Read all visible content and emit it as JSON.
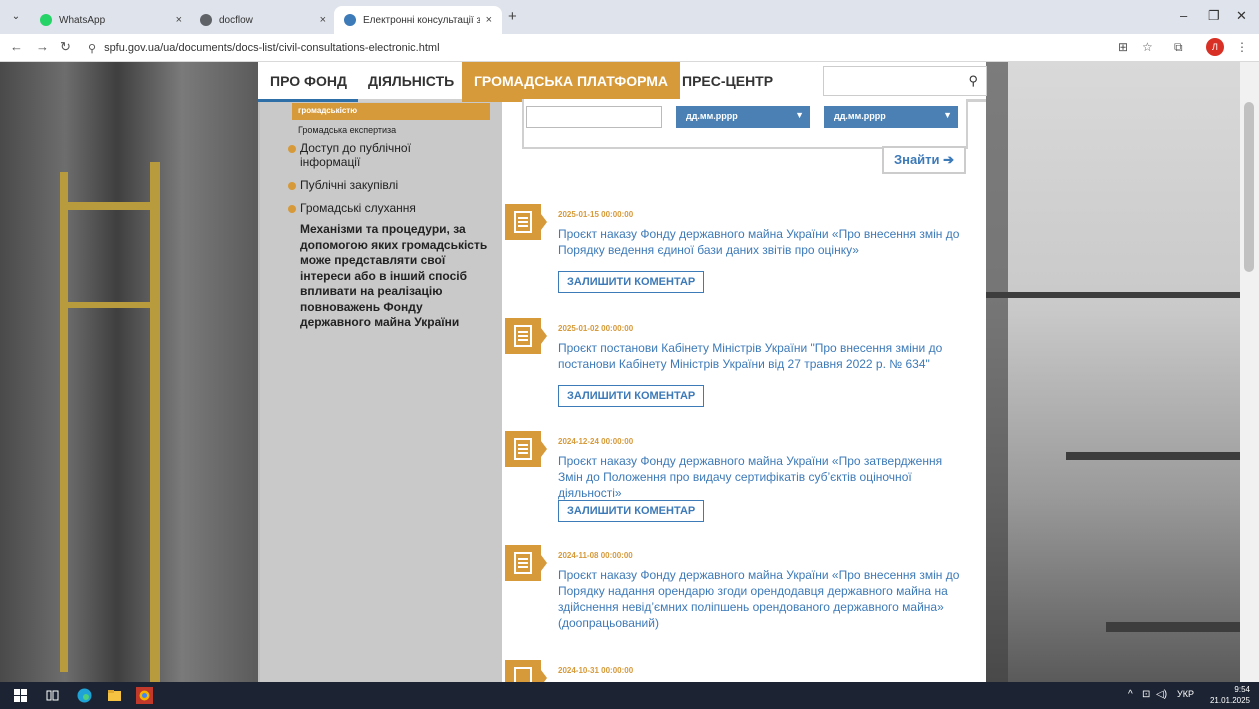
{
  "browser": {
    "tabs": [
      {
        "label": "WhatsApp",
        "icon": "whatsapp-icon",
        "color": "#25d366"
      },
      {
        "label": "docflow",
        "icon": "globe-icon",
        "color": "#5f6368"
      },
      {
        "label": "Електронні консультації з гром",
        "icon": "spfu-logo-icon",
        "color": "#3d7ab8"
      }
    ],
    "url": "spfu.gov.ua/ua/documents/docs-list/civil-consultations-electronic.html",
    "profile_initial": "Л"
  },
  "nav": {
    "items": [
      "ПРО ФОНД",
      "ДІЯЛЬНІСТЬ",
      "ГРОМАДСЬКА ПЛАТФОРМА",
      "ПРЕС-ЦЕНТР"
    ],
    "search_placeholder": ""
  },
  "sidebar": {
    "active_sub": "громадськістю",
    "small_item": "Громадська експертиза",
    "items": [
      "Доступ до публічної інформації",
      "Публічні закупівлі",
      "Громадські слухання"
    ],
    "description": "Механізми та процедури, за допомогою яких громадськість може представляти свої інтереси або в інший спосіб впливати на реалізацію повноважень Фонду державного майна України"
  },
  "filter": {
    "date_from_placeholder": "дд.мм.рррр",
    "date_to_placeholder": "дд.мм.рррр",
    "find_label": "Знайти ➔"
  },
  "documents": [
    {
      "date": "2025-01-15 00:00:00",
      "title": "Проєкт наказу Фонду державного майна України «Про внесення змін до Порядку ведення єдиної бази даних звітів про оцінку»",
      "button": "ЗАЛИШИТИ КОМЕНТАР"
    },
    {
      "date": "2025-01-02 00:00:00",
      "title": "Проєкт постанови Кабінету Міністрів України \"Про внесення зміни до постанови Кабінету Міністрів України від 27 травня 2022 р. № 634\"",
      "button": "ЗАЛИШИТИ КОМЕНТАР"
    },
    {
      "date": "2024-12-24 00:00:00",
      "title": "Проєкт наказу Фонду державного майна України «Про затвердження Змін до Положення про видачу сертифікатів суб’єктів оціночної діяльності»",
      "button": "ЗАЛИШИТИ КОМЕНТАР"
    },
    {
      "date": "2024-11-08 00:00:00",
      "title": "Проєкт наказу Фонду державного майна України «Про внесення змін до Порядку надання орендарю згоди орендодавця державного майна на здійснення невід’ємних поліпшень орендованого державного майна» (доопрацьований)",
      "button": ""
    },
    {
      "date": "2024-10-31 00:00:00",
      "title": "",
      "button": ""
    }
  ],
  "taskbar": {
    "lang": "УКР",
    "time": "9:54",
    "date": "21.01.2025"
  },
  "colors": {
    "accent": "#d69a3a",
    "link": "#3d7ab8",
    "date_select": "#4a80b3"
  }
}
